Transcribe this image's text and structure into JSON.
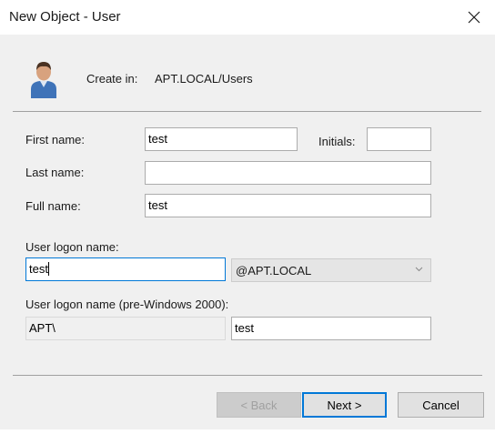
{
  "window": {
    "title": "New Object - User"
  },
  "header": {
    "create_in_label": "Create in:",
    "create_in_value": "APT.LOCAL/Users",
    "icon": "user-icon"
  },
  "form": {
    "first_name": {
      "label": "First name:",
      "value": "test"
    },
    "initials": {
      "label": "Initials:",
      "value": ""
    },
    "last_name": {
      "label": "Last name:",
      "value": ""
    },
    "full_name": {
      "label": "Full name:",
      "value": "test"
    },
    "logon_name": {
      "label": "User logon name:",
      "value": "test",
      "suffix_selected": "@APT.LOCAL"
    },
    "pre2000": {
      "label": "User logon name (pre-Windows 2000):",
      "domain": "APT\\",
      "value": "test"
    }
  },
  "buttons": {
    "back": "< Back",
    "next": "Next >",
    "cancel": "Cancel"
  },
  "colors": {
    "accent": "#0078d7",
    "dialog_bg": "#f0f0f0"
  }
}
